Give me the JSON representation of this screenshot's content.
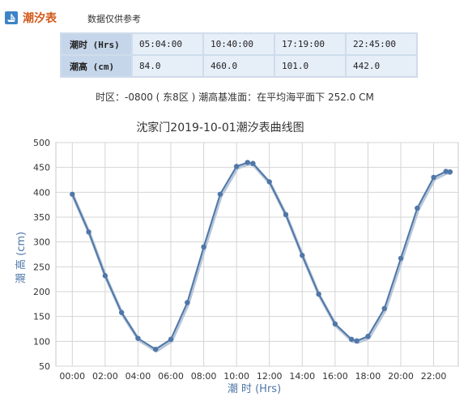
{
  "header": {
    "icon": "boat-icon",
    "title": "潮汐表",
    "note": "数据仅供参考"
  },
  "table": {
    "row_headers": [
      "潮时 (Hrs)",
      "潮高 (cm)"
    ],
    "times": [
      "05:04:00",
      "10:40:00",
      "17:19:00",
      "22:45:00"
    ],
    "heights": [
      "84.0",
      "460.0",
      "101.0",
      "442.0"
    ]
  },
  "timezone_line": "时区：-0800 ( 东8区 ) 潮高基准面：在平均海平面下 252.0 CM",
  "chart_data": {
    "type": "line",
    "title": "沈家门2019-10-01潮汐表曲线图",
    "xlabel": "潮 时 (Hrs)",
    "ylabel": "潮 高 (cm)",
    "xlim": [
      -1,
      23.5
    ],
    "ylim": [
      50,
      500
    ],
    "yticks": [
      50,
      100,
      150,
      200,
      250,
      300,
      350,
      400,
      450,
      500
    ],
    "xticks": [
      0,
      2,
      4,
      6,
      8,
      10,
      12,
      14,
      16,
      18,
      20,
      22
    ],
    "xtick_labels": [
      "00:00",
      "02:00",
      "04:00",
      "06:00",
      "08:00",
      "10:00",
      "12:00",
      "14:00",
      "16:00",
      "18:00",
      "20:00",
      "22:00"
    ],
    "grid": true,
    "line_color": "#4f77a8",
    "points": [
      [
        0,
        396
      ],
      [
        1,
        320
      ],
      [
        2,
        232
      ],
      [
        3,
        158
      ],
      [
        4,
        106
      ],
      [
        5.07,
        84
      ],
      [
        6,
        104
      ],
      [
        7,
        178
      ],
      [
        8,
        290
      ],
      [
        9,
        396
      ],
      [
        10,
        452
      ],
      [
        10.67,
        460
      ],
      [
        11,
        458
      ],
      [
        12,
        421
      ],
      [
        13,
        355
      ],
      [
        14,
        273
      ],
      [
        15,
        195
      ],
      [
        16,
        135
      ],
      [
        17,
        104
      ],
      [
        17.32,
        101
      ],
      [
        18,
        110
      ],
      [
        19,
        166
      ],
      [
        20,
        267
      ],
      [
        21,
        368
      ],
      [
        22,
        430
      ],
      [
        22.75,
        442
      ],
      [
        23,
        441
      ]
    ]
  }
}
